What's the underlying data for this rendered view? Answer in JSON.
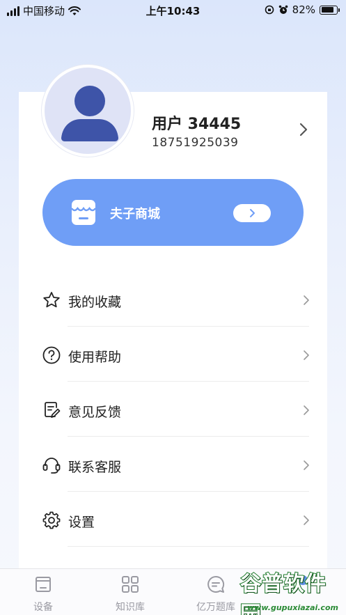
{
  "status_bar": {
    "carrier": "中国移动",
    "time": "上午10:43",
    "battery": "82%",
    "battery_level": 0.82
  },
  "profile": {
    "name": "用户 34445",
    "phone": "18751925039"
  },
  "store": {
    "label": "夫子商城"
  },
  "menu": {
    "items": [
      {
        "label": "我的收藏",
        "icon": "star-icon"
      },
      {
        "label": "使用帮助",
        "icon": "help-circle-icon"
      },
      {
        "label": "意见反馈",
        "icon": "feedback-icon"
      },
      {
        "label": "联系客服",
        "icon": "headset-icon"
      },
      {
        "label": "设置",
        "icon": "gear-icon"
      }
    ]
  },
  "tab_bar": {
    "tabs": [
      {
        "label": "设备",
        "icon": "device-icon"
      },
      {
        "label": "知识库",
        "icon": "grid-icon"
      },
      {
        "label": "亿万题库",
        "icon": "question-bank-icon"
      }
    ]
  },
  "watermark": {
    "text": "谷普软件园",
    "url": "www.gupuxiazai.com"
  },
  "colors": {
    "accent": "#6f9ef6",
    "avatar": "#3e54a8",
    "avatar_bg": "#dfe3f6"
  }
}
